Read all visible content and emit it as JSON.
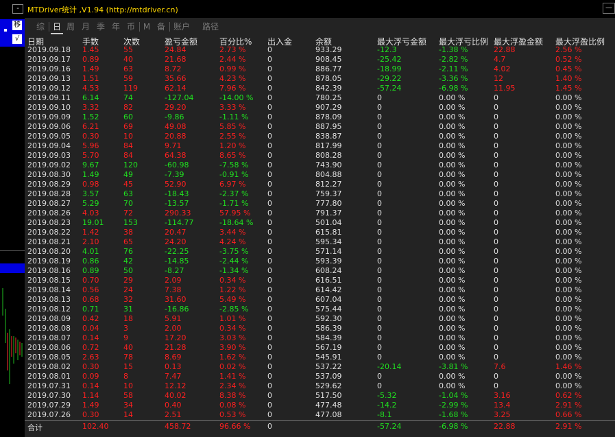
{
  "app": {
    "title": "MTDriver统计 ,V1.94 (http://mtdriver.cn)",
    "close_label": "—"
  },
  "left_panel": {
    "minimize_label": "-",
    "move_label": "移",
    "check_label": "√"
  },
  "tabs": [
    {
      "label": "综",
      "active": false
    },
    {
      "label": "日",
      "active": true
    },
    {
      "label": "周",
      "active": false
    },
    {
      "label": "月",
      "active": false
    },
    {
      "label": "季",
      "active": false
    },
    {
      "label": "年",
      "active": false
    },
    {
      "label": "币",
      "active": false
    },
    {
      "label": "M",
      "active": false
    },
    {
      "label": "备",
      "active": false
    },
    {
      "label": "账户",
      "active": false
    },
    {
      "label": "路径",
      "active": false
    }
  ],
  "columns": [
    "日期",
    "手数",
    "次数",
    "盈亏金额",
    "百分比%",
    "出入金",
    "余额",
    "最大浮亏金额",
    "最大浮亏比例",
    "最大浮盈金额",
    "最大浮盈比例"
  ],
  "rows": [
    [
      "2019.09.18",
      "1.45",
      "55",
      "24.84",
      "2.73 %",
      "0",
      "933.29",
      "-12.3",
      "-1.38 %",
      "22.88",
      "2.56 %"
    ],
    [
      "2019.09.17",
      "0.89",
      "40",
      "21.68",
      "2.44 %",
      "0",
      "908.45",
      "-25.42",
      "-2.82 %",
      "4.7",
      "0.52 %"
    ],
    [
      "2019.09.16",
      "1.49",
      "63",
      "8.72",
      "0.99 %",
      "0",
      "886.77",
      "-18.99",
      "-2.11 %",
      "4.02",
      "0.45 %"
    ],
    [
      "2019.09.13",
      "1.51",
      "59",
      "35.66",
      "4.23 %",
      "0",
      "878.05",
      "-29.22",
      "-3.36 %",
      "12",
      "1.40 %"
    ],
    [
      "2019.09.12",
      "4.53",
      "119",
      "62.14",
      "7.96 %",
      "0",
      "842.39",
      "-57.24",
      "-6.98 %",
      "11.95",
      "1.45 %"
    ],
    [
      "2019.09.11",
      "6.14",
      "74",
      "-127.04",
      "-14.00 %",
      "0",
      "780.25",
      "0",
      "0.00 %",
      "0",
      "0.00 %"
    ],
    [
      "2019.09.10",
      "3.32",
      "82",
      "29.20",
      "3.33 %",
      "0",
      "907.29",
      "0",
      "0.00 %",
      "0",
      "0.00 %"
    ],
    [
      "2019.09.09",
      "1.52",
      "60",
      "-9.86",
      "-1.11 %",
      "0",
      "878.09",
      "0",
      "0.00 %",
      "0",
      "0.00 %"
    ],
    [
      "2019.09.06",
      "6.21",
      "69",
      "49.08",
      "5.85 %",
      "0",
      "887.95",
      "0",
      "0.00 %",
      "0",
      "0.00 %"
    ],
    [
      "2019.09.05",
      "0.30",
      "10",
      "20.88",
      "2.55 %",
      "0",
      "838.87",
      "0",
      "0.00 %",
      "0",
      "0.00 %"
    ],
    [
      "2019.09.04",
      "5.96",
      "84",
      "9.71",
      "1.20 %",
      "0",
      "817.99",
      "0",
      "0.00 %",
      "0",
      "0.00 %"
    ],
    [
      "2019.09.03",
      "5.70",
      "84",
      "64.38",
      "8.65 %",
      "0",
      "808.28",
      "0",
      "0.00 %",
      "0",
      "0.00 %"
    ],
    [
      "2019.09.02",
      "9.67",
      "120",
      "-60.98",
      "-7.58 %",
      "0",
      "743.90",
      "0",
      "0.00 %",
      "0",
      "0.00 %"
    ],
    [
      "2019.08.30",
      "1.49",
      "49",
      "-7.39",
      "-0.91 %",
      "0",
      "804.88",
      "0",
      "0.00 %",
      "0",
      "0.00 %"
    ],
    [
      "2019.08.29",
      "0.98",
      "45",
      "52.90",
      "6.97 %",
      "0",
      "812.27",
      "0",
      "0.00 %",
      "0",
      "0.00 %"
    ],
    [
      "2019.08.28",
      "3.57",
      "63",
      "-18.43",
      "-2.37 %",
      "0",
      "759.37",
      "0",
      "0.00 %",
      "0",
      "0.00 %"
    ],
    [
      "2019.08.27",
      "5.29",
      "70",
      "-13.57",
      "-1.71 %",
      "0",
      "777.80",
      "0",
      "0.00 %",
      "0",
      "0.00 %"
    ],
    [
      "2019.08.26",
      "4.03",
      "72",
      "290.33",
      "57.95 %",
      "0",
      "791.37",
      "0",
      "0.00 %",
      "0",
      "0.00 %"
    ],
    [
      "2019.08.23",
      "19.01",
      "153",
      "-114.77",
      "-18.64 %",
      "0",
      "501.04",
      "0",
      "0.00 %",
      "0",
      "0.00 %"
    ],
    [
      "2019.08.22",
      "1.42",
      "38",
      "20.47",
      "3.44 %",
      "0",
      "615.81",
      "0",
      "0.00 %",
      "0",
      "0.00 %"
    ],
    [
      "2019.08.21",
      "2.10",
      "65",
      "24.20",
      "4.24 %",
      "0",
      "595.34",
      "0",
      "0.00 %",
      "0",
      "0.00 %"
    ],
    [
      "2019.08.20",
      "4.01",
      "76",
      "-22.25",
      "-3.75 %",
      "0",
      "571.14",
      "0",
      "0.00 %",
      "0",
      "0.00 %"
    ],
    [
      "2019.08.19",
      "0.86",
      "42",
      "-14.85",
      "-2.44 %",
      "0",
      "593.39",
      "0",
      "0.00 %",
      "0",
      "0.00 %"
    ],
    [
      "2019.08.16",
      "0.89",
      "50",
      "-8.27",
      "-1.34 %",
      "0",
      "608.24",
      "0",
      "0.00 %",
      "0",
      "0.00 %"
    ],
    [
      "2019.08.15",
      "0.70",
      "29",
      "2.09",
      "0.34 %",
      "0",
      "616.51",
      "0",
      "0.00 %",
      "0",
      "0.00 %"
    ],
    [
      "2019.08.14",
      "0.56",
      "24",
      "7.38",
      "1.22 %",
      "0",
      "614.42",
      "0",
      "0.00 %",
      "0",
      "0.00 %"
    ],
    [
      "2019.08.13",
      "0.68",
      "32",
      "31.60",
      "5.49 %",
      "0",
      "607.04",
      "0",
      "0.00 %",
      "0",
      "0.00 %"
    ],
    [
      "2019.08.12",
      "0.71",
      "31",
      "-16.86",
      "-2.85 %",
      "0",
      "575.44",
      "0",
      "0.00 %",
      "0",
      "0.00 %"
    ],
    [
      "2019.08.09",
      "0.42",
      "18",
      "5.91",
      "1.01 %",
      "0",
      "592.30",
      "0",
      "0.00 %",
      "0",
      "0.00 %"
    ],
    [
      "2019.08.08",
      "0.04",
      "3",
      "2.00",
      "0.34 %",
      "0",
      "586.39",
      "0",
      "0.00 %",
      "0",
      "0.00 %"
    ],
    [
      "2019.08.07",
      "0.14",
      "9",
      "17.20",
      "3.03 %",
      "0",
      "584.39",
      "0",
      "0.00 %",
      "0",
      "0.00 %"
    ],
    [
      "2019.08.06",
      "0.72",
      "40",
      "21.28",
      "3.90 %",
      "0",
      "567.19",
      "0",
      "0.00 %",
      "0",
      "0.00 %"
    ],
    [
      "2019.08.05",
      "2.63",
      "78",
      "8.69",
      "1.62 %",
      "0",
      "545.91",
      "0",
      "0.00 %",
      "0",
      "0.00 %"
    ],
    [
      "2019.08.02",
      "0.30",
      "15",
      "0.13",
      "0.02 %",
      "0",
      "537.22",
      "-20.14",
      "-3.81 %",
      "7.6",
      "1.46 %"
    ],
    [
      "2019.08.01",
      "0.09",
      "8",
      "7.47",
      "1.41 %",
      "0",
      "537.09",
      "0",
      "0.00 %",
      "0",
      "0.00 %"
    ],
    [
      "2019.07.31",
      "0.14",
      "10",
      "12.12",
      "2.34 %",
      "0",
      "529.62",
      "0",
      "0.00 %",
      "0",
      "0.00 %"
    ],
    [
      "2019.07.30",
      "1.14",
      "58",
      "40.02",
      "8.38 %",
      "0",
      "517.50",
      "-5.32",
      "-1.04 %",
      "3.16",
      "0.62 %"
    ],
    [
      "2019.07.29",
      "1.49",
      "34",
      "0.40",
      "0.08 %",
      "0",
      "477.48",
      "-14.2",
      "-2.99 %",
      "13.4",
      "2.91 %"
    ],
    [
      "2019.07.26",
      "0.30",
      "14",
      "2.51",
      "0.53 %",
      "0",
      "477.08",
      "-8.1",
      "-1.68 %",
      "3.25",
      "0.66 %"
    ]
  ],
  "footer": [
    "合计",
    "102.40",
    "",
    "458.72",
    "96.66 %",
    "0",
    "",
    "-57.24",
    "-6.98 %",
    "22.88",
    "2.91 %"
  ],
  "colors": {
    "profit": "#ff2020",
    "loss": "#20e020",
    "title": "#ffd700",
    "accent_blue": "#0000e0"
  }
}
